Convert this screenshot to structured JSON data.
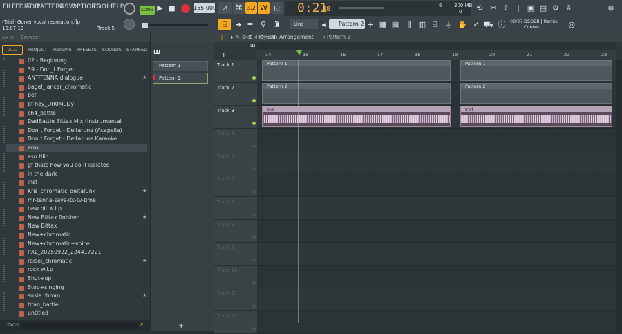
{
  "menu": [
    "FILE",
    "EDIT",
    "ADD",
    "PATTERNS",
    "VIEW",
    "OPTIONS",
    "TOOLS",
    "HELP"
  ],
  "project": {
    "title": "(Trial) Goner vocal recreation.flp",
    "time": "16:07:19",
    "track": "Track 5"
  },
  "transport": {
    "song_label": "SONG",
    "tempo": "155.000",
    "clock_main": "0:21",
    "clock_sub": "48",
    "pattern": "Pattern 2",
    "snap": "Line",
    "cpu": "6",
    "mem": "300 MB",
    "voices": "0"
  },
  "news": {
    "date": "08/27",
    "text": "DEDZII | Remix Contest"
  },
  "browser": {
    "title": "Browser",
    "tabs": [
      "ALL",
      "PROJECT",
      "PLUGINS",
      "PRESETS",
      "SOUNDS",
      "STARRED"
    ],
    "items": [
      "02 - Beginning",
      "39 - Don_t Forget",
      "ANT-TENNA dialogue",
      "bagel_lancer_chromatic",
      "bef",
      "bf-hey_DR0MuDy",
      "ch4_battle",
      "DadBattle Bittax Mix (Instrumental",
      "Don t Forget - Deltarune (Acapella)",
      "Don t Forget - Deltarune Karaoke",
      "erro",
      "eso tilin",
      "gf thats how you do it isolated",
      "in the dark",
      "inst",
      "Kris_chromatic_deltafunk",
      "mr-tenna-says-its-tv-time",
      "new bit w.i.p",
      "New Bittax finished",
      "New Bittax",
      "New+chromatic",
      "New+chromatic+voice",
      "PXL_20250922_224417221",
      "ralsei_chromatic",
      "rock w.i.p",
      "Shut+up",
      "Stop+singing",
      "susie chrom",
      "titan_battle",
      "untitled"
    ],
    "starred": [
      2,
      15,
      18,
      23,
      27
    ],
    "tags_label": "TAGS"
  },
  "channels": {
    "patterns": [
      "Pattern 1",
      "Pattern 2"
    ]
  },
  "playlist": {
    "title": "Playlist - Arrangement",
    "pattern": "Pattern 2",
    "ruler": [
      "14",
      "15",
      "16",
      "17",
      "18",
      "19",
      "20",
      "21",
      "22",
      "23"
    ],
    "tracks": [
      "Track 1",
      "Track 2",
      "Track 3",
      "Track 4",
      "Track 5",
      "Track 6",
      "Track 7",
      "Track 8",
      "Track 9",
      "Track 10",
      "Track 11",
      "Track 12"
    ],
    "clips": {
      "t1": "Pattern 1",
      "t2": "Pattern 2",
      "t3": "Inst"
    }
  },
  "colors": {
    "accent": "#f5a623",
    "bg": "#2a3136"
  }
}
